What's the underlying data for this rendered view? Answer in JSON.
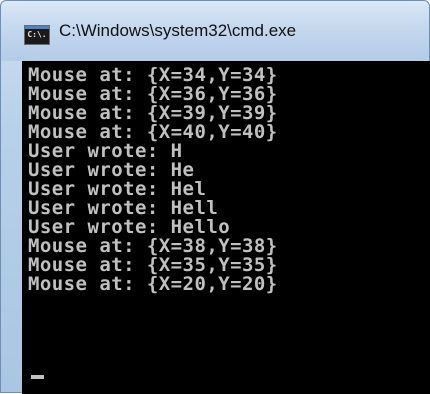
{
  "window": {
    "title": "C:\\Windows\\system32\\cmd.exe",
    "icon": "cmd-console-icon",
    "icon_label": "C:\\."
  },
  "console": {
    "lines": [
      "Mouse at: {X=34,Y=34}",
      "Mouse at: {X=36,Y=36}",
      "Mouse at: {X=39,Y=39}",
      "Mouse at: {X=40,Y=40}",
      "User wrote: H",
      "User wrote: He",
      "User wrote: Hel",
      "User wrote: Hell",
      "User wrote: Hello",
      "Mouse at: {X=38,Y=38}",
      "Mouse at: {X=35,Y=35}",
      "Mouse at: {X=20,Y=20}"
    ],
    "text_color": "#c0c0c0",
    "background_color": "#000000"
  }
}
